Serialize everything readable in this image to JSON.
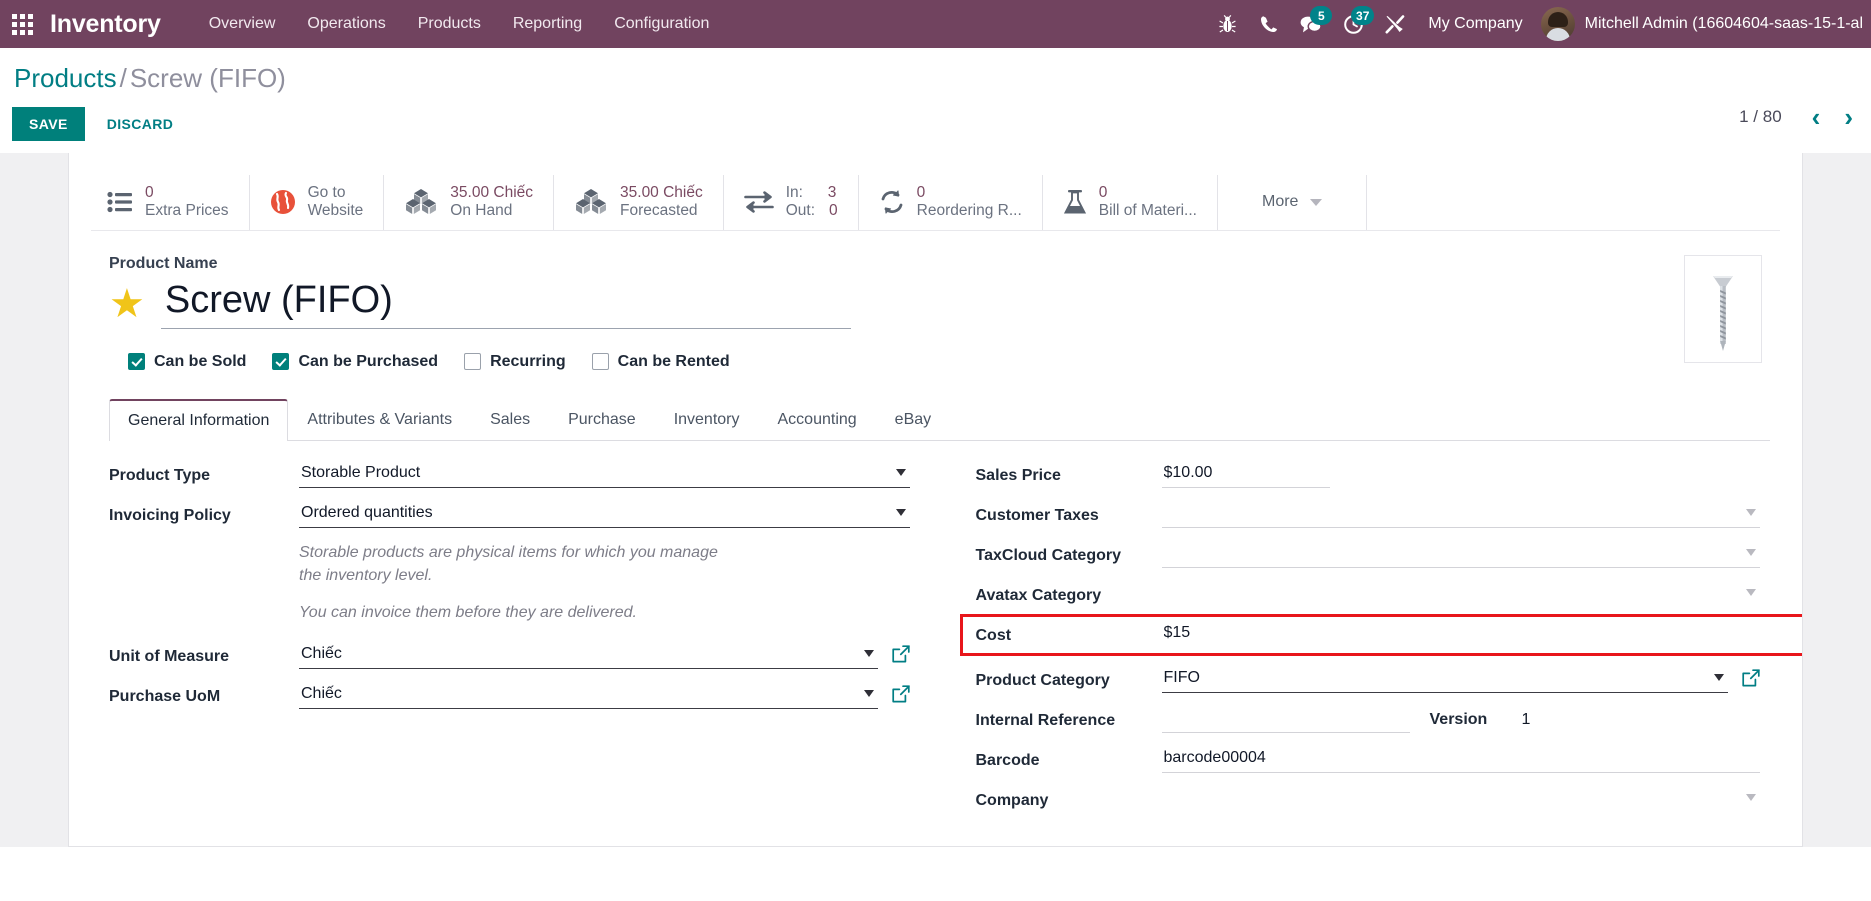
{
  "navbar": {
    "brand": "Inventory",
    "menus": [
      "Overview",
      "Operations",
      "Products",
      "Reporting",
      "Configuration"
    ],
    "icons": [
      {
        "name": "bug-icon",
        "badge": null
      },
      {
        "name": "phone-icon",
        "badge": null
      },
      {
        "name": "messages-icon",
        "badge": "5"
      },
      {
        "name": "activities-clock-icon",
        "badge": "37"
      },
      {
        "name": "tools-icon",
        "badge": null
      }
    ],
    "company": "My Company",
    "user": "Mitchell Admin (16604604-saas-15-1-al"
  },
  "breadcrumb": {
    "parent": "Products",
    "separator": "/",
    "current": "Screw (FIFO)"
  },
  "actions": {
    "save": "SAVE",
    "discard": "DISCARD"
  },
  "pager": {
    "value": "1 / 80",
    "prev": "‹",
    "next": "›"
  },
  "stat_buttons": [
    {
      "icon": "list-icon",
      "value": "0",
      "label": "Extra Prices"
    },
    {
      "icon": "globe-icon",
      "value": "Go to",
      "label": "Website"
    },
    {
      "icon": "boxes-icon",
      "value": "35.00 Chiếc",
      "label": "On Hand"
    },
    {
      "icon": "boxes-icon",
      "value": "35.00 Chiếc",
      "label": "Forecasted"
    },
    {
      "icon": "exchange-arrows-icon",
      "in_key": "In:",
      "in_value": "3",
      "out_key": "Out:",
      "out_value": "0"
    },
    {
      "icon": "refresh-icon",
      "value": "0",
      "label": "Reordering R..."
    },
    {
      "icon": "flask-icon",
      "value": "0",
      "label": "Bill of Materi..."
    }
  ],
  "more_button": "More",
  "product": {
    "name_label": "Product Name",
    "name": "Screw (FIFO)",
    "favorite_icon": "star-filled-icon",
    "image_icon": "screw-product-image",
    "checkboxes": [
      {
        "label": "Can be Sold",
        "checked": true
      },
      {
        "label": "Can be Purchased",
        "checked": true
      },
      {
        "label": "Recurring",
        "checked": false
      },
      {
        "label": "Can be Rented",
        "checked": false
      }
    ]
  },
  "tabs": [
    {
      "label": "General Information",
      "active": true
    },
    {
      "label": "Attributes & Variants",
      "active": false
    },
    {
      "label": "Sales",
      "active": false
    },
    {
      "label": "Purchase",
      "active": false
    },
    {
      "label": "Inventory",
      "active": false
    },
    {
      "label": "Accounting",
      "active": false
    },
    {
      "label": "eBay",
      "active": false
    }
  ],
  "form": {
    "left": {
      "product_type_label": "Product Type",
      "product_type_value": "Storable Product",
      "invoicing_policy_label": "Invoicing Policy",
      "invoicing_policy_value": "Ordered quantities",
      "help_1": "Storable products are physical items for which you manage the inventory level.",
      "help_2": "You can invoice them before they are delivered.",
      "uom_label": "Unit of Measure",
      "uom_value": "Chiếc",
      "purchase_uom_label": "Purchase UoM",
      "purchase_uom_value": "Chiếc"
    },
    "right": {
      "sales_price_label": "Sales Price",
      "sales_price_value": "$10.00",
      "customer_taxes_label": "Customer Taxes",
      "customer_taxes_value": "",
      "taxcloud_label": "TaxCloud Category",
      "taxcloud_value": "",
      "avatax_label": "Avatax Category",
      "avatax_value": "",
      "cost_label": "Cost",
      "cost_value": "$15",
      "product_category_label": "Product Category",
      "product_category_value": "FIFO",
      "internal_ref_label": "Internal Reference",
      "internal_ref_value": "",
      "version_label": "Version",
      "version_value": "1",
      "barcode_label": "Barcode",
      "barcode_value": "barcode00004",
      "company_label": "Company",
      "company_value": ""
    }
  },
  "colors": {
    "navbar": "#71435f",
    "accent_teal": "#017e84",
    "save_button": "#00807b",
    "badge": "#00838a",
    "highlight_red": "#e8161b",
    "star_gold": "#f0c419"
  }
}
